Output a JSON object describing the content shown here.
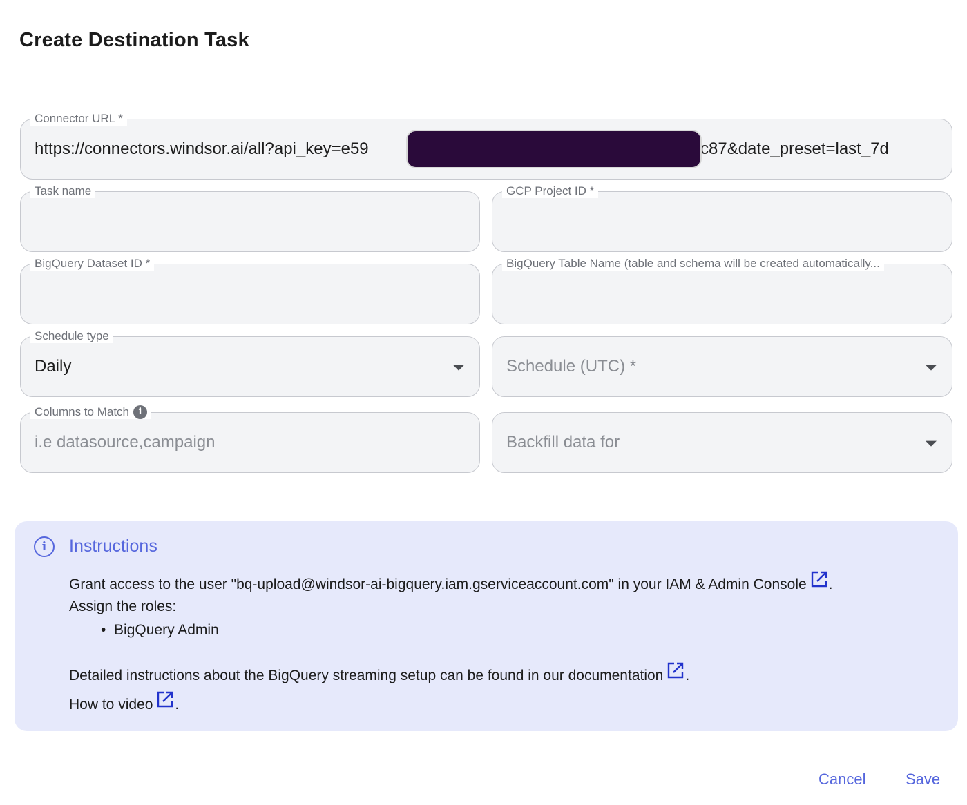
{
  "dialog": {
    "title": "Create Destination Task"
  },
  "fields": {
    "connector_url": {
      "label": "Connector URL *",
      "value_start": "https://connectors.windsor.ai/all?api_key=e59",
      "value_end": "c87&date_preset=last_7d"
    },
    "task_name": {
      "label": "Task name",
      "value": ""
    },
    "gcp_project_id": {
      "label": "GCP Project ID *",
      "value": ""
    },
    "bigquery_dataset_id": {
      "label": "BigQuery Dataset ID *",
      "value": ""
    },
    "bigquery_table_name": {
      "label": "BigQuery Table Name (table and schema will be created automatically...",
      "value": ""
    },
    "schedule_type": {
      "label": "Schedule type",
      "value": "Daily"
    },
    "schedule_utc": {
      "placeholder": "Schedule (UTC) *"
    },
    "columns_to_match": {
      "label": "Columns to Match",
      "placeholder": "i.e datasource,campaign"
    },
    "backfill": {
      "placeholder": "Backfill data for"
    }
  },
  "instructions": {
    "title": "Instructions",
    "line1": "Grant access to the user \"bq-upload@windsor-ai-bigquery.iam.gserviceaccount.com\" in your IAM & Admin Console",
    "line2": "Assign the roles:",
    "bullet": "BigQuery Admin",
    "line3": "Detailed instructions about the BigQuery streaming setup can be found in our documentation",
    "line4": "How to video",
    "period": "."
  },
  "buttons": {
    "cancel": "Cancel",
    "save": "Save"
  },
  "colors": {
    "accent": "#5566dd",
    "panel_bg": "#e6e9fb",
    "link_icon": "#2233cc"
  }
}
